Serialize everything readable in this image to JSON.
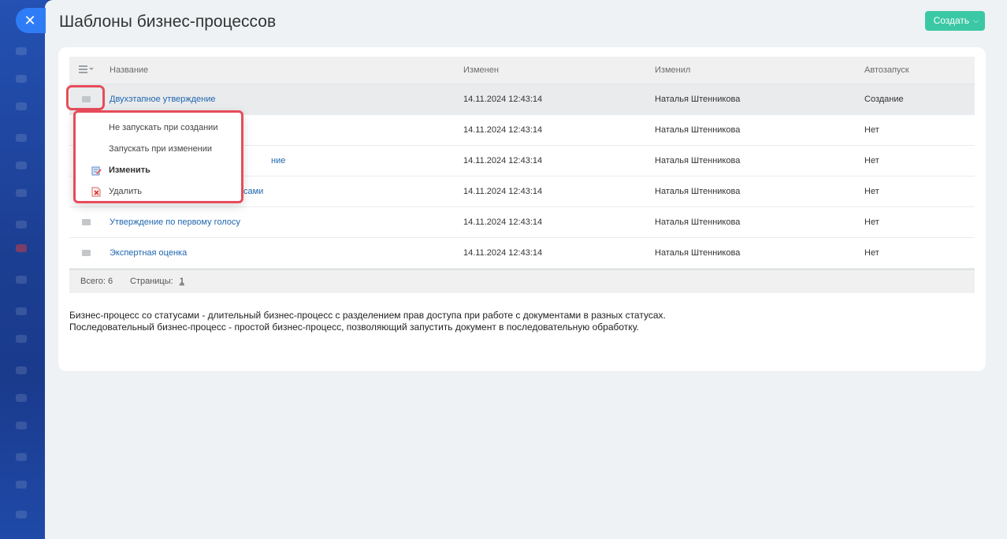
{
  "page": {
    "title": "Шаблоны бизнес-процессов",
    "create_label": "Создать"
  },
  "grid": {
    "columns": {
      "name": "Название",
      "modified": "Изменен",
      "modified_by": "Изменил",
      "autostart": "Автозапуск"
    },
    "rows": [
      {
        "name": "Двухэтапное утверждение",
        "modified": "14.11.2024 12:43:14",
        "modified_by": "Наталья Штенникова",
        "autostart": "Создание"
      },
      {
        "name": "",
        "modified": "14.11.2024 12:43:14",
        "modified_by": "Наталья Штенникова",
        "autostart": "Нет"
      },
      {
        "name": "ние",
        "modified": "14.11.2024 12:43:14",
        "modified_by": "Наталья Штенникова",
        "autostart": "Нет"
      },
      {
        "name": "сами",
        "modified": "14.11.2024 12:43:14",
        "modified_by": "Наталья Штенникова",
        "autostart": "Нет"
      },
      {
        "name": "Утверждение по первому голосу",
        "modified": "14.11.2024 12:43:14",
        "modified_by": "Наталья Штенникова",
        "autostart": "Нет"
      },
      {
        "name": "Экспертная оценка",
        "modified": "14.11.2024 12:43:14",
        "modified_by": "Наталья Штенникова",
        "autostart": "Нет"
      }
    ],
    "footer": {
      "total": "Всего: 6",
      "pages_label": "Страницы:",
      "page": "1"
    }
  },
  "context_menu": {
    "items": [
      {
        "label": "Не запускать при создании"
      },
      {
        "label": "Запускать при изменении"
      },
      {
        "label": "Изменить"
      },
      {
        "label": "Удалить"
      }
    ]
  },
  "notes": {
    "line1": "Бизнес-процесс со статусами - длительный бизнес-процесс с разделением прав доступа при работе с документами в разных статусах.",
    "line2": "Последовательный бизнес-процесс - простой бизнес-процесс, позволяющий запустить документ в последовательную обработку."
  },
  "colors": {
    "accent_green": "#3bc8a5",
    "link_blue": "#2067b0",
    "highlight_red": "#e84c5a",
    "close_blue": "#2f7df6"
  },
  "icons": {
    "close": "close-icon",
    "grid_settings": "list-settings-icon",
    "row_menu": "row-menu-icon",
    "edit": "edit-pencil-icon",
    "delete": "delete-icon"
  }
}
